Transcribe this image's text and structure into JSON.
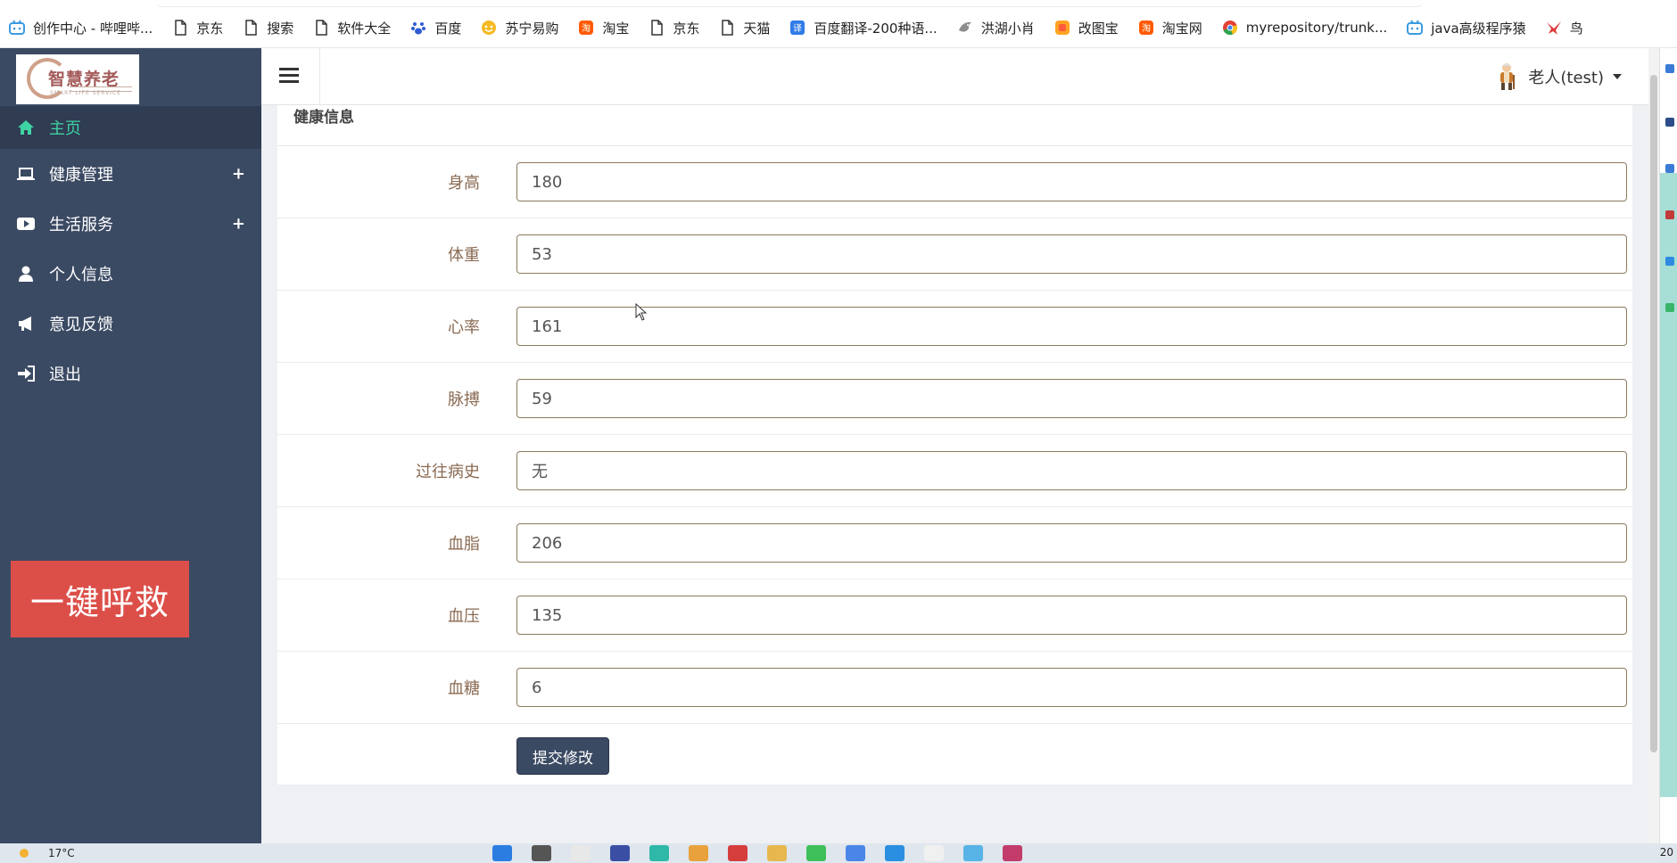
{
  "bookmarks": [
    {
      "icon": "bilibili-icon",
      "label": "创作中心 - 哔哩哔..."
    },
    {
      "icon": "page-icon",
      "label": "京东"
    },
    {
      "icon": "page-icon",
      "label": "搜索"
    },
    {
      "icon": "page-icon",
      "label": "软件大全"
    },
    {
      "icon": "baidu-icon",
      "label": "百度"
    },
    {
      "icon": "suning-icon",
      "label": "苏宁易购"
    },
    {
      "icon": "taobao-icon",
      "label": "淘宝"
    },
    {
      "icon": "page-icon",
      "label": "京东"
    },
    {
      "icon": "page-icon",
      "label": "天猫"
    },
    {
      "icon": "translate-icon",
      "label": "百度翻译-200种语..."
    },
    {
      "icon": "bird-icon",
      "label": "洪湖小肖"
    },
    {
      "icon": "gaitubao-icon",
      "label": "改图宝"
    },
    {
      "icon": "taobao-icon",
      "label": "淘宝网"
    },
    {
      "icon": "chrome-icon",
      "label": "myrepository/trunk..."
    },
    {
      "icon": "bilibili-icon",
      "label": "java高级程序猿"
    },
    {
      "icon": "swallow-icon",
      "label": "鸟"
    }
  ],
  "logo": {
    "text": "智慧养老",
    "sub": "SMART LIFE SERVICE"
  },
  "sidebar": {
    "items": [
      {
        "icon": "home-icon",
        "label": "主页",
        "active": true,
        "expand": ""
      },
      {
        "icon": "laptop-icon",
        "label": "健康管理",
        "active": false,
        "expand": "+"
      },
      {
        "icon": "video-icon",
        "label": "生活服务",
        "active": false,
        "expand": "+"
      },
      {
        "icon": "user-icon",
        "label": "个人信息",
        "active": false,
        "expand": ""
      },
      {
        "icon": "megaphone-icon",
        "label": "意见反馈",
        "active": false,
        "expand": ""
      },
      {
        "icon": "logout-icon",
        "label": "退出",
        "active": false,
        "expand": ""
      }
    ],
    "sos_label": "一键呼救"
  },
  "header": {
    "user_label": "老人(test)"
  },
  "panel": {
    "title": "健康信息",
    "fields": [
      {
        "label": "身高",
        "value": "180"
      },
      {
        "label": "体重",
        "value": "53"
      },
      {
        "label": "心率",
        "value": "161"
      },
      {
        "label": "脉搏",
        "value": "59"
      },
      {
        "label": "过往病史",
        "value": "无"
      },
      {
        "label": "血脂",
        "value": "206"
      },
      {
        "label": "血压",
        "value": "135"
      },
      {
        "label": "血糖",
        "value": "6"
      }
    ],
    "submit_label": "提交修改"
  },
  "taskbar": {
    "weather": "17°C",
    "clock": "20"
  },
  "colors": {
    "sidebar": "#3b4a63",
    "accent": "#3fd3a3",
    "sos": "#dc4f49",
    "label": "#8a6a52"
  }
}
